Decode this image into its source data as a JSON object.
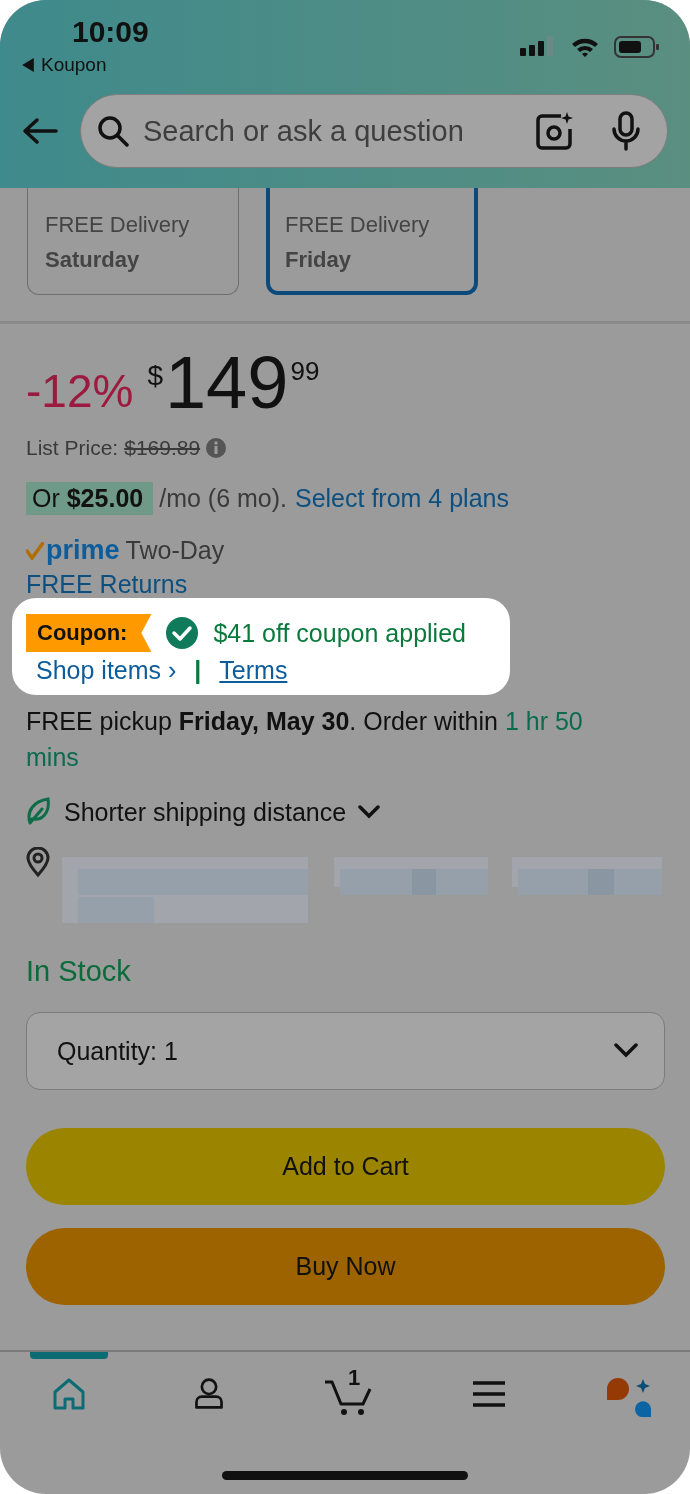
{
  "status_bar": {
    "time": "10:09",
    "back_app": "Koupon"
  },
  "search": {
    "placeholder": "Search or ask a question"
  },
  "delivery_options": [
    {
      "label": "FREE Delivery",
      "day": "Saturday",
      "selected": false
    },
    {
      "label": "FREE Delivery",
      "day": "Friday",
      "selected": true
    }
  ],
  "price": {
    "discount": "-12%",
    "currency": "$",
    "whole": "149",
    "fraction": "99"
  },
  "list_price": {
    "label": "List Price:",
    "value": "$169.89"
  },
  "installment": {
    "badge": "Or **$25.00**",
    "text": "/mo (6 mo).",
    "link": "Select from 4 plans"
  },
  "prime": {
    "logo": "prime",
    "text": "Two-Day"
  },
  "returns_link": "FREE Returns",
  "coupon": {
    "badge": "Coupon:",
    "applied": "$41 off coupon applied",
    "shop_link": "Shop items ›",
    "separator": "|",
    "terms_link": "Terms"
  },
  "pickup": {
    "text": "FREE pickup **Friday, May 30**. Order within ",
    "countdown": "1 hr 50 mins"
  },
  "shipping": {
    "label": "Shorter shipping distance",
    "expanded": false
  },
  "stock": "In Stock",
  "quantity": {
    "label": "Quantity:",
    "value": "1"
  },
  "buttons": [
    {
      "kind": "cart",
      "label": "Add to Cart"
    },
    {
      "kind": "buy",
      "label": "Buy Now"
    }
  ],
  "nav": [
    {
      "kind": "home",
      "selected": true
    },
    {
      "kind": "account",
      "selected": false
    },
    {
      "kind": "cart",
      "badge": "1",
      "selected": false
    },
    {
      "kind": "menu",
      "selected": false
    },
    {
      "kind": "assistant",
      "selected": false
    }
  ]
}
